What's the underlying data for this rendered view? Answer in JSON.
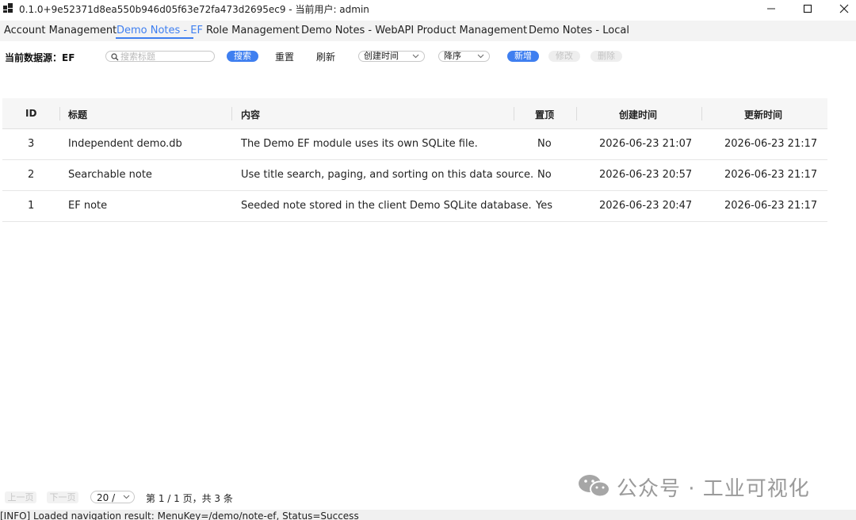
{
  "window": {
    "title": "0.1.0+9e52371d8ea550b946d05f63e72fa473d2695ec9 - 当前用户: admin",
    "app_icon": "windows-grid-icon",
    "controls": [
      "minimize-icon",
      "maximize-icon",
      "close-icon"
    ]
  },
  "tabs": [
    {
      "label": "Account Management",
      "active": false
    },
    {
      "label": "Demo Notes - EF",
      "active": true
    },
    {
      "label": "Role Management",
      "active": false
    },
    {
      "label": "Demo Notes - WebAPI",
      "active": false
    },
    {
      "label": "Product Management",
      "active": false
    },
    {
      "label": "Demo Notes - Local",
      "active": false
    }
  ],
  "toolbar": {
    "datasource_label": "当前数据源：EF",
    "search_placeholder": "搜索标题",
    "search_value": "",
    "search_label": "搜索",
    "reset_label": "重置",
    "refresh_label": "刷新",
    "sort_field": "创建时间",
    "sort_order": "降序",
    "add_label": "新增",
    "edit_label": "修改",
    "delete_label": "删除"
  },
  "table": {
    "columns": [
      "ID",
      "标题",
      "内容",
      "置顶",
      "创建时间",
      "更新时间"
    ],
    "rows": [
      [
        "3",
        "Independent demo.db",
        "The Demo EF module uses its own SQLite file.",
        "No",
        "2026-06-23 21:07",
        "2026-06-23 21:17"
      ],
      [
        "2",
        "Searchable note",
        "Use title search, paging, and sorting on this data source.",
        "No",
        "2026-06-23 20:57",
        "2026-06-23 21:17"
      ],
      [
        "1",
        "EF note",
        "Seeded note stored in the client Demo SQLite database.",
        "Yes",
        "2026-06-23 20:47",
        "2026-06-23 21:17"
      ]
    ]
  },
  "pager": {
    "prev_label": "上一页",
    "next_label": "下一页",
    "page_size": "20 /",
    "info": "第 1 / 1 页，共 3 条"
  },
  "status": "[INFO] Loaded navigation result: MenuKey=/demo/note-ef, Status=Success",
  "watermark": {
    "text": "公众号 · 工业可视化",
    "icon": "wechat-icon"
  },
  "colors": {
    "accent": "#3f7ff0",
    "header_bg": "#f6f6f6",
    "tabbar_bg": "#f3f3f3",
    "disabled_text": "#c4c4c4"
  }
}
